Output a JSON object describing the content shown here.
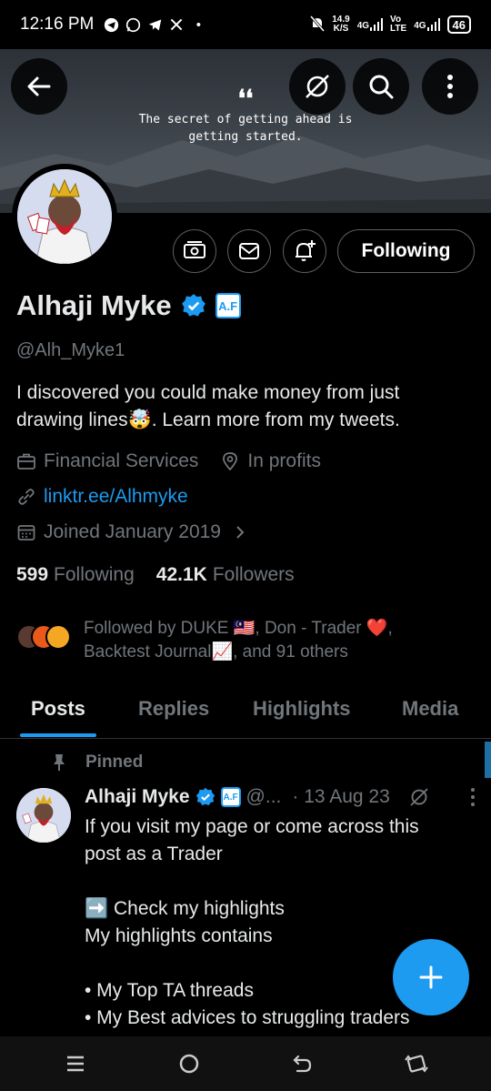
{
  "status_bar": {
    "time": "12:16 PM",
    "speed_value": "14.9",
    "speed_unit": "K/S",
    "network_1": "4G",
    "network_2_top": "Vo",
    "network_2_bottom": "LTE",
    "network_3": "4G",
    "battery": "46"
  },
  "banner": {
    "quote_mark": "❛❛",
    "quote_line1": "The secret of getting ahead is",
    "quote_line2": "getting started."
  },
  "profile": {
    "name": "Alhaji Myke",
    "badge_text": "A.F",
    "handle": "@Alh_Myke1",
    "bio_line1": "I discovered you could make money from just",
    "bio_line2": "drawing lines🤯. Learn more from my tweets.",
    "category": "Financial Services",
    "location": "In profits",
    "link": "linktr.ee/Alhmyke",
    "joined": "Joined January 2019",
    "following_count": "599",
    "following_label": "Following",
    "followers_count": "42.1K",
    "followers_label": "Followers",
    "followed_by_line1": "Followed by DUKE 🇲🇾, Don - Trader ❤️,",
    "followed_by_line2": "Backtest Journal📈, and 91 others",
    "following_button": "Following"
  },
  "tabs": [
    "Posts",
    "Replies",
    "Highlights",
    "Media"
  ],
  "tweet": {
    "pinned_label": "Pinned",
    "name": "Alhaji Myke",
    "badge_text": "A.F",
    "handle": "@...",
    "date": "· 13 Aug 23",
    "lines": [
      "If you visit my page or come across this",
      "post as a Trader",
      "",
      "➡️ Check my highlights",
      "My highlights contains",
      "",
      "• My Top TA threads",
      "• My Best advices to struggling traders"
    ]
  },
  "colors": {
    "accent": "#1d9bf0",
    "muted": "#71767b",
    "text": "#e7e9ea"
  }
}
